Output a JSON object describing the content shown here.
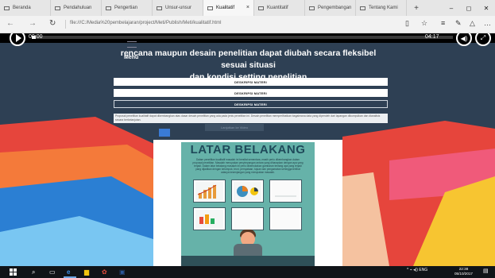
{
  "browser": {
    "tabs": [
      {
        "label": "Beranda"
      },
      {
        "label": "Pendahuluan"
      },
      {
        "label": "Pengertian"
      },
      {
        "label": "Unsur-unsur"
      },
      {
        "label": "Kualitatif",
        "active": true,
        "close": "×"
      },
      {
        "label": "Kuantitatif"
      },
      {
        "label": "Pengembangan"
      },
      {
        "label": "Tentang Kami"
      }
    ],
    "new_tab": "+",
    "window_controls": {
      "minimize": "–",
      "maximize": "◻",
      "close": "✕"
    },
    "nav": {
      "back": "←",
      "forward": "→",
      "refresh": "↻"
    },
    "url": "file:///C:/Media%20pembelajaran/project/Meti/Publish/Meti/kualitatif.html",
    "tools": [
      "reading-view-icon",
      "favorite-star-icon",
      "hub-icon",
      "notes-icon",
      "share-icon",
      "more-icon"
    ]
  },
  "video": {
    "time_current": "00:00",
    "time_total": "04:17",
    "progress_fraction": 0.01
  },
  "lesson": {
    "menu_label": "Menu",
    "headline_line1": "rencana maupun desain penelitian dapat diubah secara fleksibel sesuai situasi",
    "headline_line2": "dan kondisi setting penelitian",
    "buttons": [
      {
        "label": "DESKRIPSI MATERI"
      },
      {
        "label": "DESKRIPSI MATERI"
      },
      {
        "label": "DESKRIPSI MATERI",
        "selected": true
      }
    ],
    "description": "Proposal penelitian kualitatif dapat dikembangkan atas dasar desain penelitian yang ada pada jenis penelitian ini. Desain penelitian memperlihatkan bagaimana data yang diperoleh dari lapangan dikumpulkan dan dianalisis secara berkelanjutan.",
    "ghost_button": "Lanjutkan ke Video"
  },
  "slide": {
    "title": "LATAR BELAKANG",
    "body": "Dalam penelitian kualitatif masalah ini bersifat sementara, masih perlu dikembangkan dalam proposal penelitian. Masalah merupakan penyimpangan antara yang diharapkan dengan apa yang terjadi. Dalam latar belakang masalah ini perlu dikemukakan gambaran tentang apa yang terjadi yang dijadikan dengan kelompok, teori, pernyataan, tujuan dan pengamatan sehingga terlihat adanya kesenjangan yang merupakan masalah."
  },
  "taskbar": {
    "icons": [
      "windows-start-icon",
      "search-icon",
      "task-view-icon",
      "edge-icon",
      "file-explorer-icon",
      "app-icon",
      "word-icon"
    ],
    "tray_text": "^ ⌁ ◂)) ENG",
    "time": "22:38",
    "date": "05/10/2017"
  },
  "colors": {
    "page_bg": "#2e4054",
    "slide_bg": "#66b2a9",
    "slide_title": "#1f4a5a"
  }
}
